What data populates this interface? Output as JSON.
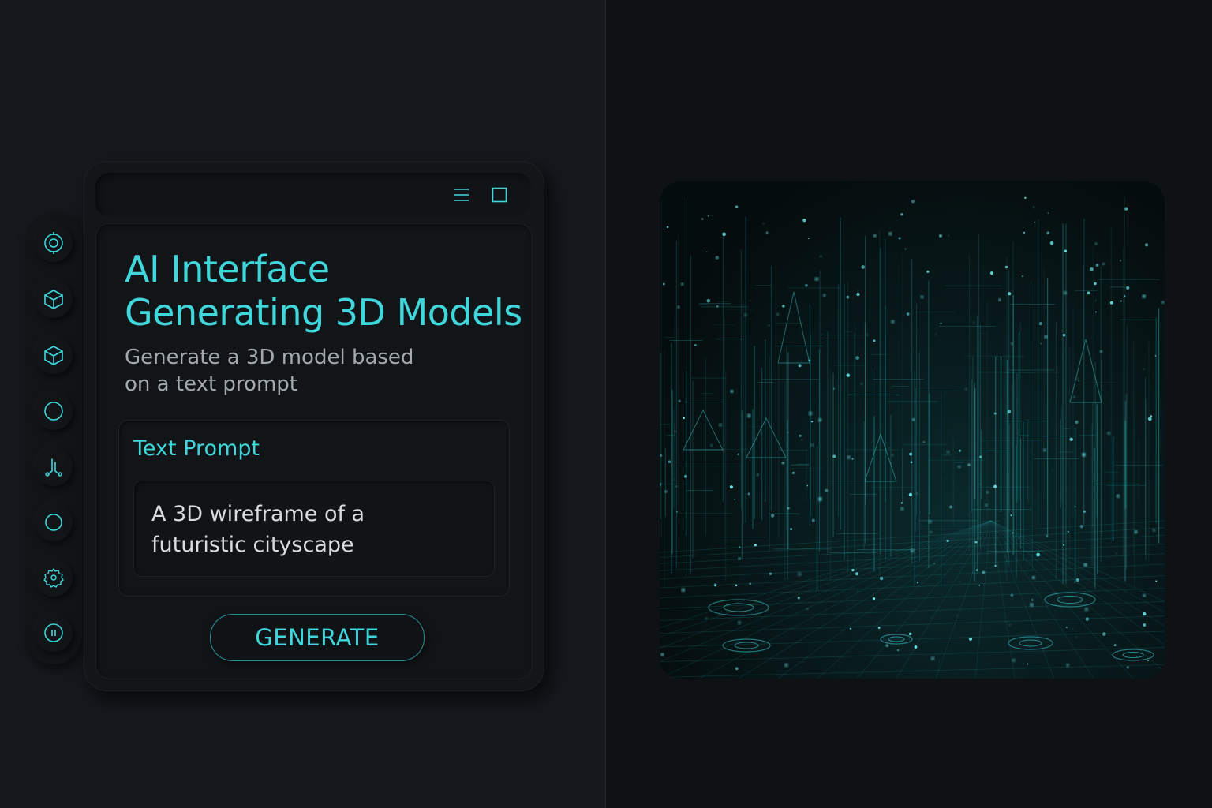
{
  "header": {
    "menu_icon": "hamburger-menu-icon",
    "window_icon": "square-window-icon"
  },
  "sidebar": {
    "items": [
      {
        "icon": "target-icon"
      },
      {
        "icon": "cube-icon"
      },
      {
        "icon": "cube-outline-icon"
      },
      {
        "icon": "circle-icon"
      },
      {
        "icon": "branch-icon"
      },
      {
        "icon": "circle-small-icon"
      },
      {
        "icon": "gear-icon"
      },
      {
        "icon": "pause-icon"
      }
    ]
  },
  "main": {
    "title_line1": "AI Interface",
    "title_line2": "Generating 3D Models",
    "subtitle_line1": "Generate a 3D model based",
    "subtitle_line2": "on a text prompt",
    "prompt": {
      "label": "Text Prompt",
      "value_line1": "A 3D wireframe of a",
      "value_line2": "futuristic cityscape"
    },
    "generate_label": "GENERATE"
  },
  "preview": {
    "subject": "3D wireframe futuristic cityscape"
  },
  "colors": {
    "accent": "#3fd7dc",
    "background": "#14171b",
    "text_muted": "#a4a9ad"
  }
}
